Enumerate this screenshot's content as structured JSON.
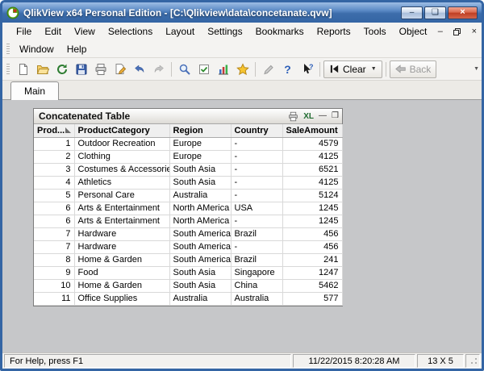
{
  "window": {
    "title": "QlikView x64 Personal Edition - [C:\\Qlikview\\data\\concetanate.qvw]"
  },
  "icons": {
    "minimize_glyph": "–",
    "maximize_glyph": "❑",
    "close_glyph": "×",
    "mdi_minimize_glyph": "–",
    "mdi_close_glyph": "×",
    "dropdown_glyph": "▼",
    "help_glyph": "?",
    "excel_label": "XL",
    "caption_minimize_glyph": "—",
    "caption_maximize_glyph": "❒",
    "toolbar_icon_names": [
      "new-document",
      "open-file",
      "reload",
      "save",
      "print",
      "edit-script",
      "undo",
      "redo",
      "search",
      "current-selections",
      "quick-chart",
      "bookmark-star",
      "edit-module",
      "help",
      "whats-this",
      "clear",
      "back"
    ]
  },
  "menu": {
    "row1": [
      "File",
      "Edit",
      "View",
      "Selections",
      "Layout",
      "Settings",
      "Bookmarks",
      "Reports",
      "Tools",
      "Object"
    ],
    "row2": [
      "Window",
      "Help"
    ]
  },
  "toolbar": {
    "clear_label": "Clear",
    "back_label": "Back"
  },
  "tabs": [
    {
      "label": "Main"
    }
  ],
  "table": {
    "title": "Concatenated Table",
    "headers": [
      "Prod...",
      "ProductCategory",
      "Region",
      "Country",
      "SaleAmount"
    ],
    "rows": [
      [
        "1",
        "Outdoor Recreation",
        "Europe",
        "-",
        "4579"
      ],
      [
        "2",
        "Clothing",
        "Europe",
        "-",
        "4125"
      ],
      [
        "3",
        "Costumes & Accessories",
        "South Asia",
        "-",
        "6521"
      ],
      [
        "4",
        "Athletics",
        "South Asia",
        "-",
        "4125"
      ],
      [
        "5",
        "Personal Care",
        "Australia",
        "-",
        "5124"
      ],
      [
        "6",
        "Arts & Entertainment",
        "North AMerica",
        "USA",
        "1245"
      ],
      [
        "6",
        "Arts & Entertainment",
        "North AMerica",
        "-",
        "1245"
      ],
      [
        "7",
        "Hardware",
        "South America",
        "Brazil",
        "456"
      ],
      [
        "7",
        "Hardware",
        "South America",
        "-",
        "456"
      ],
      [
        "8",
        "Home & Garden",
        "South America",
        "Brazil",
        "241"
      ],
      [
        "9",
        "Food",
        "South Asia",
        "Singapore",
        "1247"
      ],
      [
        "10",
        "Home & Garden",
        "South Asia",
        "China",
        "5462"
      ],
      [
        "11",
        "Office Supplies",
        "Australia",
        "Australia",
        "577"
      ]
    ]
  },
  "statusbar": {
    "help_text": "For Help, press F1",
    "timestamp": "11/22/2015 8:20:28 AM",
    "dimensions": "13 X 5"
  }
}
